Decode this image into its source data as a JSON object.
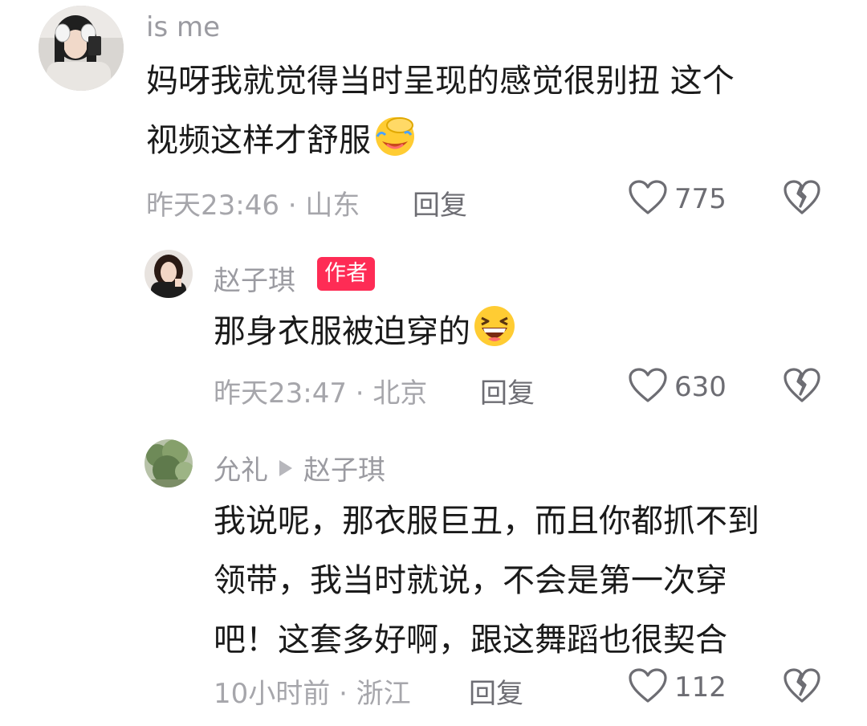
{
  "comments": [
    {
      "username": "is me",
      "text_line1": "妈呀我就觉得当时呈现的感觉很别扭 这个",
      "text_line2": "视频这样才舒服",
      "meta": "昨天23:46 · 山东",
      "reply_label": "回复",
      "likes": "775"
    },
    {
      "username": "赵子琪",
      "badge": "作者",
      "text": "那身衣服被迫穿的",
      "meta": "昨天23:47 · 北京",
      "reply_label": "回复",
      "likes": "630"
    },
    {
      "username": "允礼",
      "reply_to": "赵子琪",
      "text_line1": "我说呢，那衣服巨丑，而且你都抓不到",
      "text_line2": "领带，我当时就说，不会是第一次穿",
      "text_line3": "吧！这套多好啊，跟这舞蹈也很契合",
      "meta": "10小时前 · 浙江",
      "reply_label": "回复",
      "likes": "112"
    }
  ],
  "icons": {
    "like": "heart-outline-icon",
    "dislike": "broken-heart-icon",
    "emoji_facepalm": "facepalm-emoji",
    "emoji_laugh": "laughing-emoji"
  },
  "colors": {
    "badge_bg": "#fe2c55",
    "username": "#9b9ba1",
    "meta": "#a6a6ab"
  }
}
